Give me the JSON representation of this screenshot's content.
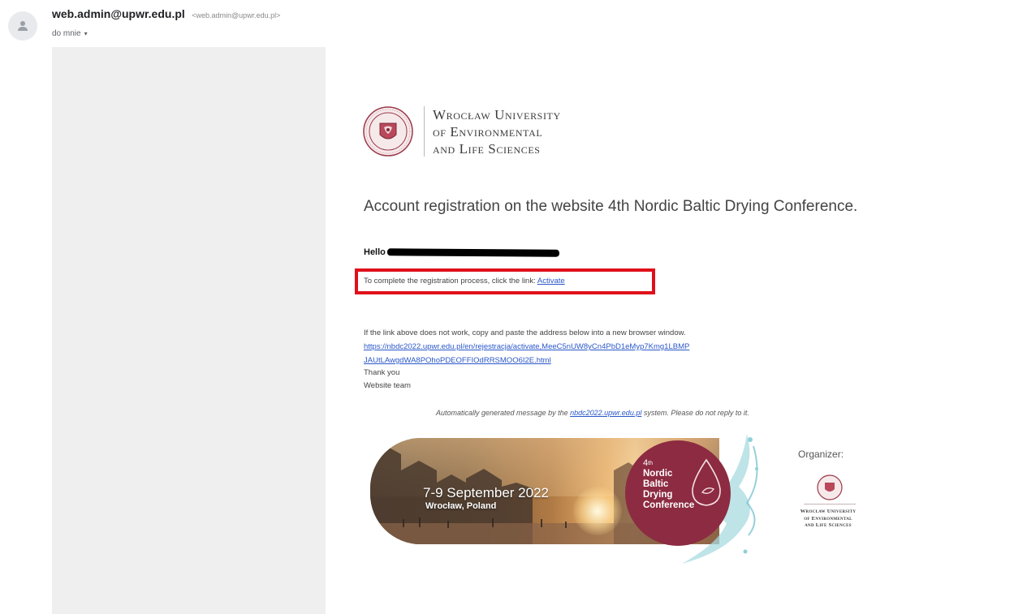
{
  "header": {
    "sender_name": "web.admin@upwr.edu.pl",
    "sender_email": "<web.admin@upwr.edu.pl>",
    "recipient_label": "do mnie",
    "recipient_caret": "▾"
  },
  "logo": {
    "line1": "Wrocław University",
    "line2": "of Environmental",
    "line3": "and Life Sciences"
  },
  "email": {
    "heading": "Account registration on the website 4th Nordic Baltic Drying Conference.",
    "greeting": "Hello",
    "activate_text": "To complete the registration process, click the link: ",
    "activate_link": "Activate",
    "fallback_text": "If the link above does not work, copy and paste the address below into a new browser window.",
    "url_line1": "https://nbdc2022.upwr.edu.pl/en/rejestracja/activate,MeeC5nUW8yCn4PbD1eMyp7Kmg1LBMP",
    "url_line2": "JAUtLAwgdWA8POhoPDEOFFIOdRRSMOO6I2E.html",
    "thanks": "Thank you",
    "signature": "Website team",
    "auto_prefix": "Automatically generated message by the ",
    "auto_link": "nbdc2022.upwr.edu.pl",
    "auto_suffix": " system. Please do not reply to it."
  },
  "banner": {
    "date": "7-9 September 2022",
    "city": "Wrocław, Poland",
    "edition": "4",
    "edition_suffix": "th",
    "conf_line1": "Nordic",
    "conf_line2": "Baltic",
    "conf_line3": "Drying",
    "conf_line4": "Conference",
    "organizer_label": "Organizer:",
    "org_line1": "Wrocław University",
    "org_line2": "of Environmental",
    "org_line3": "and Life Sciences"
  },
  "colors": {
    "highlight_border": "#e0101a",
    "link": "#2a57c9",
    "conference_maroon": "#8c2b41"
  },
  "icons": {
    "avatar": "person-icon",
    "seal": "university-seal-icon",
    "drop": "water-drop-icon"
  }
}
